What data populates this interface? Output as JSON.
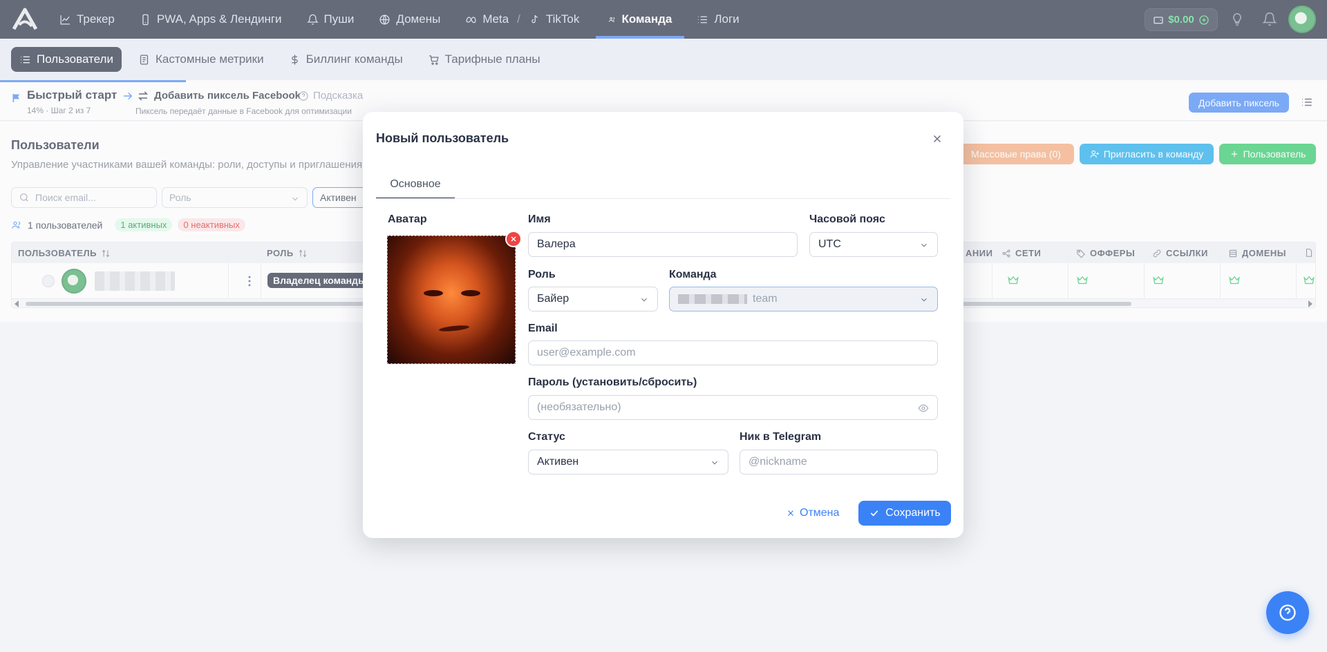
{
  "nav": {
    "items": [
      {
        "label": "Трекер",
        "icon": "chart-line-icon"
      },
      {
        "label": "PWA, Apps & Лендинги",
        "icon": "smartphone-icon"
      },
      {
        "label": "Пуши",
        "icon": "bell-icon"
      },
      {
        "label": "Домены",
        "icon": "globe-icon"
      },
      {
        "label": "Meta",
        "icon": "meta-icon"
      },
      {
        "label": "TikTok",
        "icon": "tiktok-icon"
      },
      {
        "label": "Команда",
        "icon": "users-icon"
      },
      {
        "label": "Логи",
        "icon": "list-icon"
      }
    ],
    "separator": "/",
    "active": "Команда",
    "balance": "$0.00"
  },
  "subnav": {
    "tabs": [
      {
        "label": "Пользователи"
      },
      {
        "label": "Кастомные метрики"
      },
      {
        "label": "Биллинг команды"
      },
      {
        "label": "Тарифные планы"
      }
    ]
  },
  "quick_start": {
    "title": "Быстрый старт",
    "step": "14% · Шаг 2 из 7",
    "action": "Добавить пиксель Facebook",
    "hint": "Подсказка",
    "description": "Пиксель передаёт данные в Facebook для оптимизации",
    "add_pixel_button": "Добавить пиксель"
  },
  "users_page": {
    "title": "Пользователи",
    "subtitle": "Управление участниками вашей команды: роли, доступы и приглашения",
    "mass_rights_button": "Массовые права (0)",
    "invite_button": "Пригласить в команду",
    "add_user_button": "Пользователь",
    "search_placeholder": "Поиск email...",
    "role_filter_placeholder": "Роль",
    "status_filter_value": "Активен",
    "users_count": "1 пользователей",
    "active_count": "1 активных",
    "inactive_count": "0 неактивных",
    "columns": {
      "user": "ПОЛЬЗОВАТЕЛЬ",
      "role": "РОЛЬ",
      "campaigns": "АНИИ",
      "networks": "СЕТИ",
      "offers": "ОФФЕРЫ",
      "links": "ССЫЛКИ",
      "domains": "ДОМЕНЫ"
    },
    "row": {
      "role": "Владелец команды"
    }
  },
  "modal": {
    "title": "Новый пользователь",
    "tab": "Основное",
    "avatar_label": "Аватар",
    "name_label": "Имя",
    "name_value": "Валера",
    "timezone_label": "Часовой пояс",
    "timezone_value": "UTC",
    "role_label": "Роль",
    "role_value": "Байер",
    "team_label": "Команда",
    "team_value": "team",
    "email_label": "Email",
    "email_placeholder": "user@example.com",
    "password_label": "Пароль (установить/сбросить)",
    "password_placeholder": "(необязательно)",
    "status_label": "Статус",
    "status_value": "Активен",
    "telegram_label": "Ник в Telegram",
    "telegram_placeholder": "@nickname",
    "cancel_button": "Отмена",
    "save_button": "Сохранить"
  },
  "colors": {
    "nav_bg": "#1a2236",
    "accent": "#3b82f6",
    "success": "#22c55e",
    "danger": "#ef4444",
    "warning": "#f4a574"
  }
}
